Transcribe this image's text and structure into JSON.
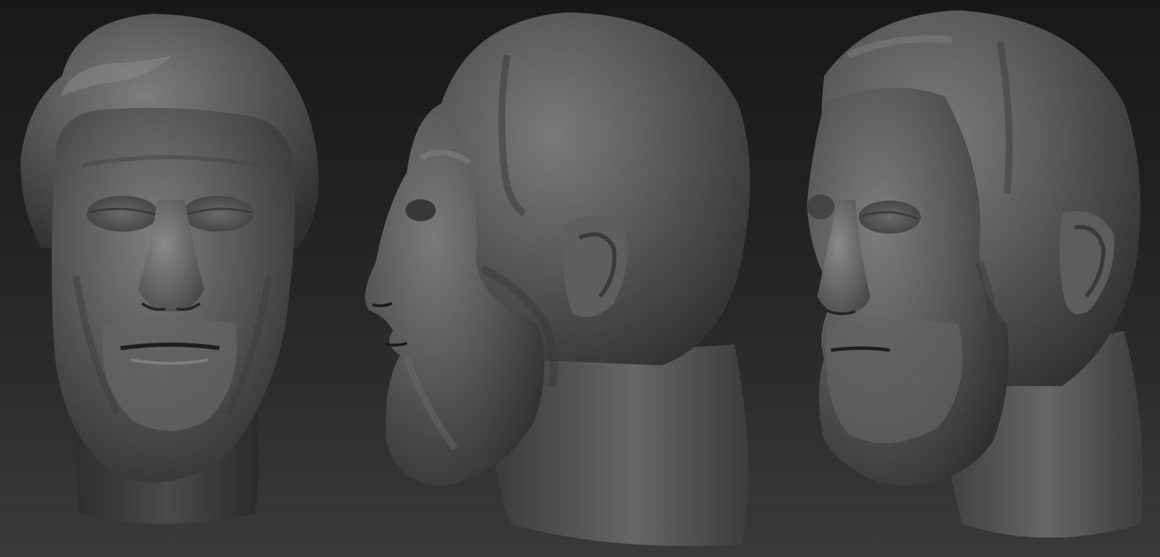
{
  "scene": {
    "background_top": "#181818",
    "background_bottom": "#3a3a3a",
    "clay_base": "#555555",
    "clay_light": "#7a7a7a",
    "clay_dark": "#2e2e2e",
    "views": [
      {
        "name": "front"
      },
      {
        "name": "side-profile"
      },
      {
        "name": "three-quarter"
      }
    ]
  }
}
